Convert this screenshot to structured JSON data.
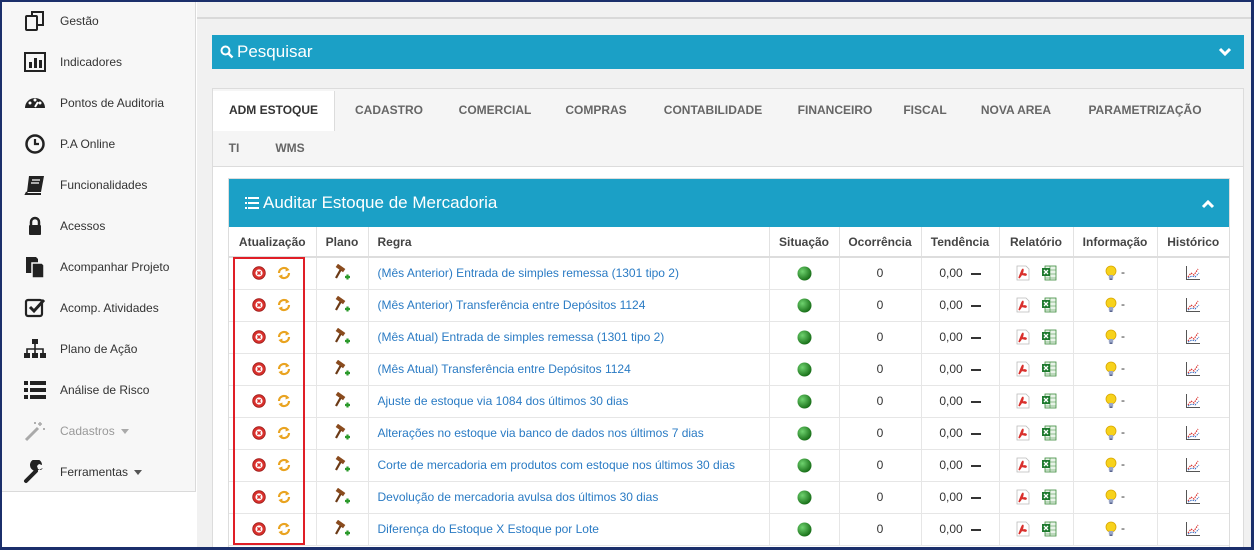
{
  "sidebar": {
    "items": [
      {
        "label": "Gestão",
        "icon": "copy-icon"
      },
      {
        "label": "Indicadores",
        "icon": "bar-chart-icon"
      },
      {
        "label": "Pontos de Auditoria",
        "icon": "dashboard-icon"
      },
      {
        "label": "P.A Online",
        "icon": "clock-icon"
      },
      {
        "label": "Funcionalidades",
        "icon": "book-icon"
      },
      {
        "label": "Acessos",
        "icon": "lock-icon"
      },
      {
        "label": "Acompanhar Projeto",
        "icon": "document-icon"
      },
      {
        "label": "Acomp. Atividades",
        "icon": "checkbox-icon"
      },
      {
        "label": "Plano de Ação",
        "icon": "sitemap-icon"
      },
      {
        "label": "Análise de Risco",
        "icon": "list-icon"
      },
      {
        "label": "Cadastros",
        "icon": "magic-wand-icon",
        "disabled": true
      },
      {
        "label": "Ferramentas",
        "icon": "wrench-icon"
      }
    ]
  },
  "search": {
    "title": "Pesquisar"
  },
  "tabs": [
    "ADM ESTOQUE",
    "CADASTRO",
    "COMERCIAL",
    "COMPRAS",
    "CONTABILIDADE",
    "FINANCEIRO",
    "FISCAL",
    "NOVA AREA",
    "PARAMETRIZAÇÃO",
    "TI",
    "WMS"
  ],
  "active_tab": "ADM ESTOQUE",
  "audit": {
    "title": "Auditar Estoque de Mercadoria",
    "columns": [
      "Atualização",
      "Plano",
      "Regra",
      "Situação",
      "Ocorrência",
      "Tendência",
      "Relatório",
      "Informação",
      "Histórico"
    ],
    "rows": [
      {
        "rule": "(Mês Anterior) Entrada de simples remessa (1301 tipo 2)",
        "occurrence": "0",
        "trend": "0,00",
        "info": "-"
      },
      {
        "rule": "(Mês Anterior) Transferência entre Depósitos 1124",
        "occurrence": "0",
        "trend": "0,00",
        "info": "-"
      },
      {
        "rule": "(Mês Atual) Entrada de simples remessa (1301 tipo 2)",
        "occurrence": "0",
        "trend": "0,00",
        "info": "-"
      },
      {
        "rule": "(Mês Atual) Transferência entre Depósitos 1124",
        "occurrence": "0",
        "trend": "0,00",
        "info": "-"
      },
      {
        "rule": "Ajuste de estoque via 1084 dos últimos 30 dias",
        "occurrence": "0",
        "trend": "0,00",
        "info": "-"
      },
      {
        "rule": "Alterações no estoque via banco de dados nos últimos 7 dias",
        "occurrence": "0",
        "trend": "0,00",
        "info": "-"
      },
      {
        "rule": "Corte de mercadoria em produtos com estoque nos últimos 30 dias",
        "occurrence": "0",
        "trend": "0,00",
        "info": "-"
      },
      {
        "rule": "Devolução de mercadoria avulsa dos últimos 30 dias",
        "occurrence": "0",
        "trend": "0,00",
        "info": "-"
      },
      {
        "rule": "Diferença do Estoque X Estoque por Lote",
        "occurrence": "0",
        "trend": "0,00",
        "info": "-"
      }
    ]
  },
  "colors": {
    "accent": "#1ba0c6",
    "link": "#2a7bc4",
    "highlight": "#e01e26",
    "status_ok": "#2e8b2e"
  }
}
